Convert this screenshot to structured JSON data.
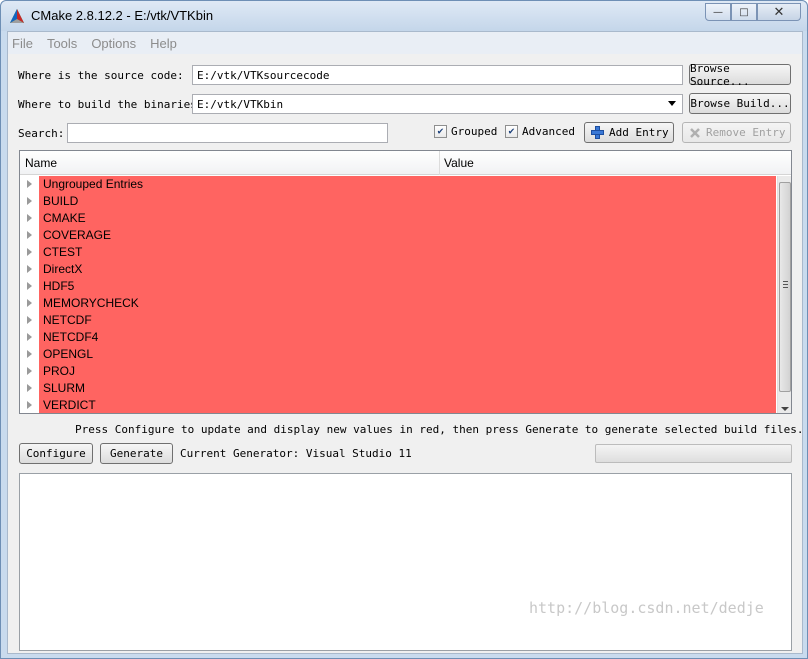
{
  "window": {
    "title": "CMake 2.8.12.2 - E:/vtk/VTKbin",
    "controls": {
      "minimize": "—",
      "maximize": "□",
      "close": "✕"
    }
  },
  "menu": [
    "File",
    "Tools",
    "Options",
    "Help"
  ],
  "source": {
    "label": "Where is the source code:",
    "value": "E:/vtk/VTKsourcecode",
    "browse_label": "Browse Source..."
  },
  "build": {
    "label": "Where to build the binaries:",
    "value": "E:/vtk/VTKbin",
    "browse_label": "Browse Build..."
  },
  "search": {
    "label": "Search:",
    "value": ""
  },
  "options": {
    "grouped": {
      "label": "Grouped",
      "checked": true
    },
    "advanced": {
      "label": "Advanced",
      "checked": true
    }
  },
  "actions": {
    "add_entry": "Add Entry",
    "remove_entry": "Remove Entry"
  },
  "tree": {
    "columns": [
      "Name",
      "Value"
    ],
    "rows": [
      "Ungrouped Entries",
      "BUILD",
      "CMAKE",
      "COVERAGE",
      "CTEST",
      "DirectX",
      "HDF5",
      "MEMORYCHECK",
      "NETCDF",
      "NETCDF4",
      "OPENGL",
      "PROJ",
      "SLURM",
      "VERDICT"
    ],
    "highlight_color": "#ff6461"
  },
  "hint": "Press Configure to update and display new values in red, then press Generate to generate selected build files.",
  "bottom": {
    "configure_label": "Configure",
    "generate_label": "Generate",
    "generator_text": "Current Generator: Visual Studio 11"
  },
  "watermark": "http://blog.csdn.net/dedje",
  "icons": {
    "app": "cmake-triangle-icon",
    "add": "plus-icon",
    "remove": "x-icon"
  }
}
